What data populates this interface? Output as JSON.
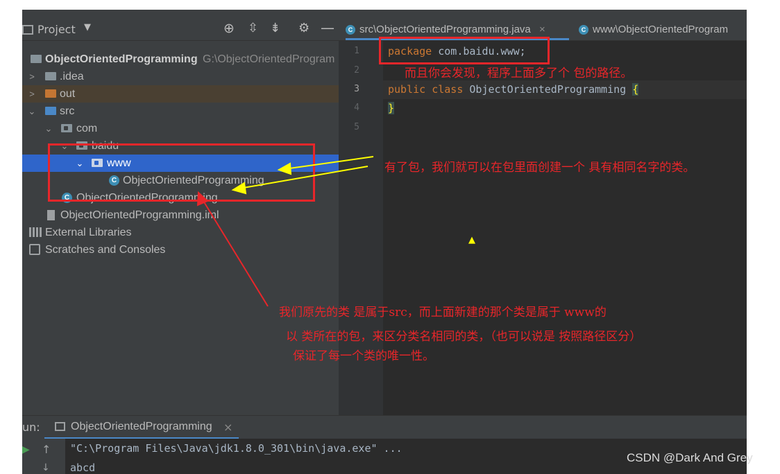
{
  "project_panel": {
    "title": "Project",
    "tree": [
      {
        "label": "ObjectOrientedProgramming",
        "path": "G:\\ObjectOrientedProgram"
      },
      {
        "label": ".idea"
      },
      {
        "label": "out"
      },
      {
        "label": "src"
      },
      {
        "label": "com"
      },
      {
        "label": "baidu"
      },
      {
        "label": "www"
      },
      {
        "label": "ObjectOrientedProgramming"
      },
      {
        "label": "ObjectOrientedProgramming"
      },
      {
        "label": "ObjectOrientedProgramming.iml"
      },
      {
        "label": "External Libraries"
      },
      {
        "label": "Scratches and Consoles"
      }
    ]
  },
  "editor": {
    "tabs": [
      {
        "label": "src\\ObjectOrientedProgramming.java",
        "close": "×"
      },
      {
        "label": "www\\ObjectOrientedProgram"
      }
    ],
    "line_numbers": [
      "1",
      "2",
      "3",
      "4",
      "5"
    ],
    "code": {
      "line1_kw": "package",
      "line1_rest": " com.baidu.www;",
      "line3_kw1": "public",
      "line3_kw2": "class",
      "line3_rest": " ObjectOrientedProgramming ",
      "line3_brace": "{",
      "line4": "}"
    },
    "class_icon_letter": "C"
  },
  "run_panel": {
    "prefix": "un:",
    "tab_label": "ObjectOrientedProgramming",
    "tab_close": "×",
    "output": [
      "\"C:\\Program Files\\Java\\jdk1.8.0_301\\bin\\java.exe\" ...",
      "abcd"
    ]
  },
  "annotations": {
    "note1": "而且你会发现，程序上面多了个 包的路径。",
    "note2": "有了包，我们就可以在包里面创建一个 具有相同名字的类。",
    "note3": "我们原先的类 是属于src，而上面新建的那个类是属于 www的",
    "note4": "以 类所在的包，来区分类名相同的类，（也可以说是 按照路径区分）",
    "note5": "保证了每一个类的唯一性。"
  },
  "watermark": "CSDN @Dark And Grey",
  "colors": {
    "annotation_red": "#e8262a",
    "arrow_yellow": "#ffff00",
    "keyword": "#cc7832",
    "selection": "#2f65ca"
  }
}
